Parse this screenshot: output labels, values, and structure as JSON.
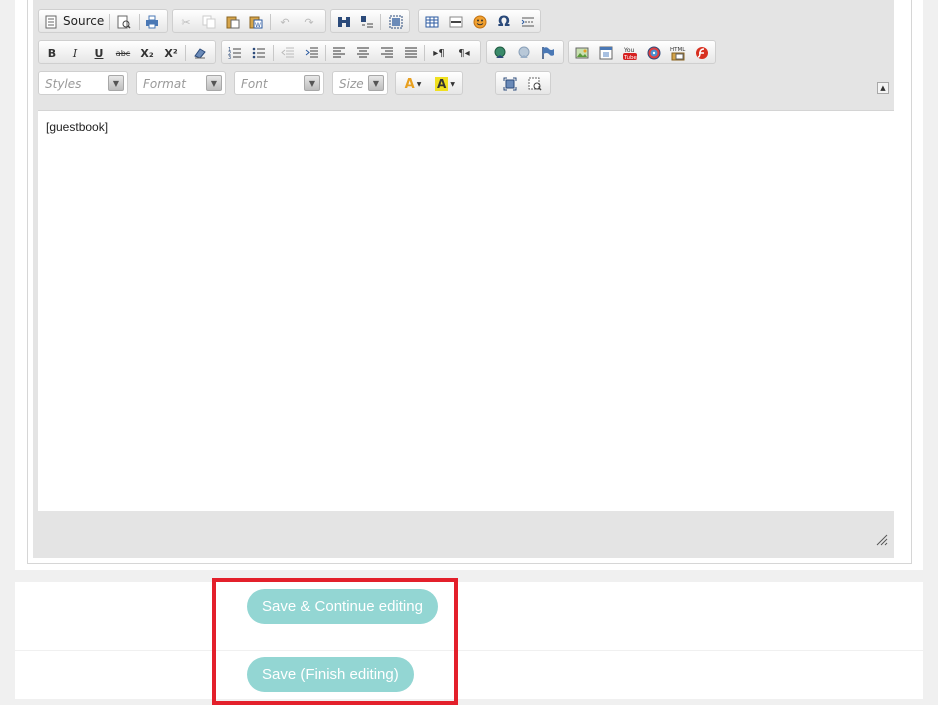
{
  "toolbar": {
    "source_label": "Source",
    "styles_combo": "Styles",
    "format_combo": "Format",
    "font_combo": "Font",
    "size_combo": "Size",
    "bold": "B",
    "italic": "I",
    "underline": "U",
    "strike": "abc",
    "subscript": "X₂",
    "superscript": "X²",
    "html_label": "HTML",
    "youtube_label": "You Tube",
    "text_color_glyph": "A",
    "bg_color_glyph": "A"
  },
  "editor": {
    "content": "[guestbook]"
  },
  "actions": {
    "save_continue": "Save & Continue editing",
    "save_finish": "Save (Finish editing)"
  },
  "colors": {
    "button_bg": "#93d6d3",
    "highlight": "#e3202b",
    "editor_chrome": "#e4e4e4"
  }
}
